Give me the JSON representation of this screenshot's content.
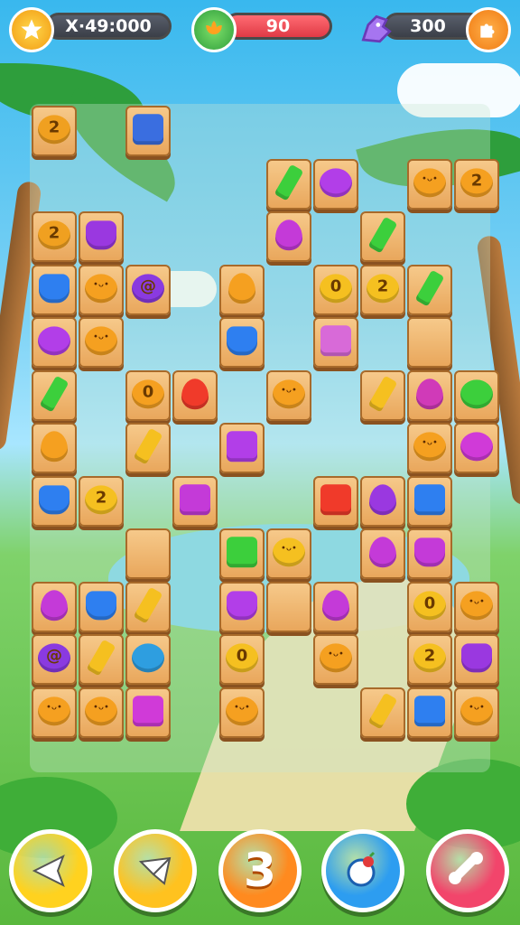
{
  "hud": {
    "score_display": "X·49:000",
    "lives_display": "90",
    "gems_display": "300",
    "left_icon": "star-icon",
    "mid_icon": "flower-icon",
    "gem_icon": "dragon-gem-icon",
    "right_icon": "puzzle-icon"
  },
  "buttons": [
    {
      "name": "back-button",
      "icon": "arrow-left-icon",
      "color": "#ffd21f"
    },
    {
      "name": "shuffle-button",
      "icon": "envelope-arrow-icon",
      "color": "#ffc21f"
    },
    {
      "name": "hint-button",
      "icon": "question-icon",
      "color": "#ff8a1f",
      "label": "3"
    },
    {
      "name": "powerup-button",
      "icon": "bomb-icon",
      "color": "#2d9df0"
    },
    {
      "name": "remove-button",
      "icon": "bone-icon",
      "color": "#f2456b"
    }
  ],
  "tiles": [
    {
      "c": 0,
      "r": 0,
      "kind": "round",
      "color": "#f0a020",
      "glyph": "2"
    },
    {
      "c": 2,
      "r": 0,
      "kind": "square",
      "color": "#3a6ee0"
    },
    {
      "c": 5,
      "r": 1,
      "kind": "bar",
      "color": "#3ccf3c"
    },
    {
      "c": 6,
      "r": 1,
      "kind": "round",
      "color": "#b23ee8"
    },
    {
      "c": 8,
      "r": 1,
      "kind": "round",
      "color": "#f5a020",
      "face": true
    },
    {
      "c": 9,
      "r": 1,
      "kind": "round",
      "color": "#f5a020",
      "glyph": "2"
    },
    {
      "c": 0,
      "r": 2,
      "kind": "round",
      "color": "#f0a020",
      "glyph": "2"
    },
    {
      "c": 1,
      "r": 2,
      "kind": "pot",
      "color": "#9a38e0"
    },
    {
      "c": 5,
      "r": 2,
      "kind": "drop",
      "color": "#c43ad8"
    },
    {
      "c": 7,
      "r": 2,
      "kind": "bar",
      "color": "#3ccf3c"
    },
    {
      "c": 0,
      "r": 3,
      "kind": "pot",
      "color": "#2e7ff0"
    },
    {
      "c": 1,
      "r": 3,
      "kind": "round",
      "color": "#f5a020",
      "face": true
    },
    {
      "c": 2,
      "r": 3,
      "kind": "round",
      "color": "#8a3ae0",
      "glyph": "@"
    },
    {
      "c": 4,
      "r": 3,
      "kind": "drop",
      "color": "#f5a020"
    },
    {
      "c": 6,
      "r": 3,
      "kind": "round",
      "color": "#f5c020",
      "glyph": "0"
    },
    {
      "c": 7,
      "r": 3,
      "kind": "round",
      "color": "#f5c020",
      "glyph": "2"
    },
    {
      "c": 8,
      "r": 3,
      "kind": "bar",
      "color": "#3ccf3c"
    },
    {
      "c": 0,
      "r": 4,
      "kind": "round",
      "color": "#b23ee8"
    },
    {
      "c": 1,
      "r": 4,
      "kind": "round",
      "color": "#f5a020",
      "face": true
    },
    {
      "c": 4,
      "r": 4,
      "kind": "pot",
      "color": "#2e7ff0"
    },
    {
      "c": 6,
      "r": 4,
      "kind": "square",
      "color": "#d86ad8"
    },
    {
      "c": 8,
      "r": 4,
      "kind": "empty"
    },
    {
      "c": 0,
      "r": 5,
      "kind": "bar",
      "color": "#3ccf3c"
    },
    {
      "c": 2,
      "r": 5,
      "kind": "round",
      "color": "#f5a020",
      "glyph": "0"
    },
    {
      "c": 3,
      "r": 5,
      "kind": "drop",
      "color": "#f03a2a"
    },
    {
      "c": 5,
      "r": 5,
      "kind": "round",
      "color": "#f5a020",
      "face": true
    },
    {
      "c": 7,
      "r": 5,
      "kind": "bar",
      "color": "#f5c020"
    },
    {
      "c": 8,
      "r": 5,
      "kind": "drop",
      "color": "#d03ab8"
    },
    {
      "c": 9,
      "r": 5,
      "kind": "round",
      "color": "#3ccf3c"
    },
    {
      "c": 0,
      "r": 6,
      "kind": "drop",
      "color": "#f5a020"
    },
    {
      "c": 2,
      "r": 6,
      "kind": "bar",
      "color": "#f5c020"
    },
    {
      "c": 4,
      "r": 6,
      "kind": "square",
      "color": "#b23ee8"
    },
    {
      "c": 8,
      "r": 6,
      "kind": "round",
      "color": "#f5a020",
      "face": true
    },
    {
      "c": 9,
      "r": 6,
      "kind": "round",
      "color": "#d03ad8"
    },
    {
      "c": 0,
      "r": 7,
      "kind": "pot",
      "color": "#2e7ff0"
    },
    {
      "c": 1,
      "r": 7,
      "kind": "round",
      "color": "#f5c020",
      "glyph": "2"
    },
    {
      "c": 3,
      "r": 7,
      "kind": "square",
      "color": "#c43ad8"
    },
    {
      "c": 6,
      "r": 7,
      "kind": "square",
      "color": "#f03a2a"
    },
    {
      "c": 7,
      "r": 7,
      "kind": "drop",
      "color": "#9a38e0"
    },
    {
      "c": 8,
      "r": 7,
      "kind": "square",
      "color": "#2e7ff0"
    },
    {
      "c": 2,
      "r": 8,
      "kind": "empty"
    },
    {
      "c": 4,
      "r": 8,
      "kind": "square",
      "color": "#3ccf3c"
    },
    {
      "c": 5,
      "r": 8,
      "kind": "round",
      "color": "#f5c020",
      "face": true
    },
    {
      "c": 7,
      "r": 8,
      "kind": "drop",
      "color": "#c43ad8"
    },
    {
      "c": 8,
      "r": 8,
      "kind": "pot",
      "color": "#c43ad8"
    },
    {
      "c": 0,
      "r": 9,
      "kind": "drop",
      "color": "#c43ad8"
    },
    {
      "c": 1,
      "r": 9,
      "kind": "pot",
      "color": "#2e7ff0"
    },
    {
      "c": 2,
      "r": 9,
      "kind": "bar",
      "color": "#f5c020"
    },
    {
      "c": 4,
      "r": 9,
      "kind": "pot",
      "color": "#b23ee8"
    },
    {
      "c": 5,
      "r": 9,
      "kind": "empty"
    },
    {
      "c": 6,
      "r": 9,
      "kind": "drop",
      "color": "#c43ad8"
    },
    {
      "c": 8,
      "r": 9,
      "kind": "round",
      "color": "#f5c020",
      "glyph": "0"
    },
    {
      "c": 9,
      "r": 9,
      "kind": "round",
      "color": "#f5a020",
      "face": true
    },
    {
      "c": 0,
      "r": 10,
      "kind": "round",
      "color": "#8a3ae0",
      "glyph": "@"
    },
    {
      "c": 1,
      "r": 10,
      "kind": "bar",
      "color": "#f5c020"
    },
    {
      "c": 2,
      "r": 10,
      "kind": "round",
      "color": "#2e9ee0"
    },
    {
      "c": 4,
      "r": 10,
      "kind": "round",
      "color": "#f5c020",
      "glyph": "0"
    },
    {
      "c": 6,
      "r": 10,
      "kind": "round",
      "color": "#f5a020",
      "face": true
    },
    {
      "c": 8,
      "r": 10,
      "kind": "round",
      "color": "#f5c020",
      "glyph": "2"
    },
    {
      "c": 9,
      "r": 10,
      "kind": "pot",
      "color": "#9a38e0"
    },
    {
      "c": 0,
      "r": 11,
      "kind": "round",
      "color": "#f5a020",
      "face": true
    },
    {
      "c": 1,
      "r": 11,
      "kind": "round",
      "color": "#f5a020",
      "face": true
    },
    {
      "c": 2,
      "r": 11,
      "kind": "square",
      "color": "#d03ad8"
    },
    {
      "c": 4,
      "r": 11,
      "kind": "round",
      "color": "#f5a020",
      "face": true
    },
    {
      "c": 7,
      "r": 11,
      "kind": "bar",
      "color": "#f5c020"
    },
    {
      "c": 8,
      "r": 11,
      "kind": "square",
      "color": "#2e7ff0"
    },
    {
      "c": 9,
      "r": 11,
      "kind": "round",
      "color": "#f5a020",
      "face": true
    }
  ]
}
